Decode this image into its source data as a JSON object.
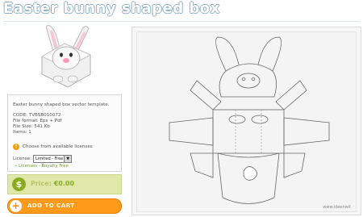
{
  "page": {
    "title": "Easter bunny shaped box"
  },
  "info": {
    "description": "Easter bunny shaped box vector template.",
    "code": "CODE: TVBSB010072",
    "file_format": "File format: Eps + Pdf",
    "file_size": "File Size: 541 Kb",
    "items": "Items: 1",
    "choose_text": "Choose from available licenses",
    "license_label": "License:",
    "license_selected": "Limited - Free",
    "licenses_link": "» Licenses - Royalty Free"
  },
  "price": {
    "label": "Price:",
    "value": "€0.00"
  },
  "cart": {
    "label": "ADD TO CART"
  },
  "preview": {
    "watermark": "www.ideenwit"
  },
  "colors": {
    "accent_green": "#8aaa22",
    "price_bg": "#dfe8a9",
    "cart_orange": "#ff9a1a",
    "title_outline": "#8fb0c3"
  }
}
